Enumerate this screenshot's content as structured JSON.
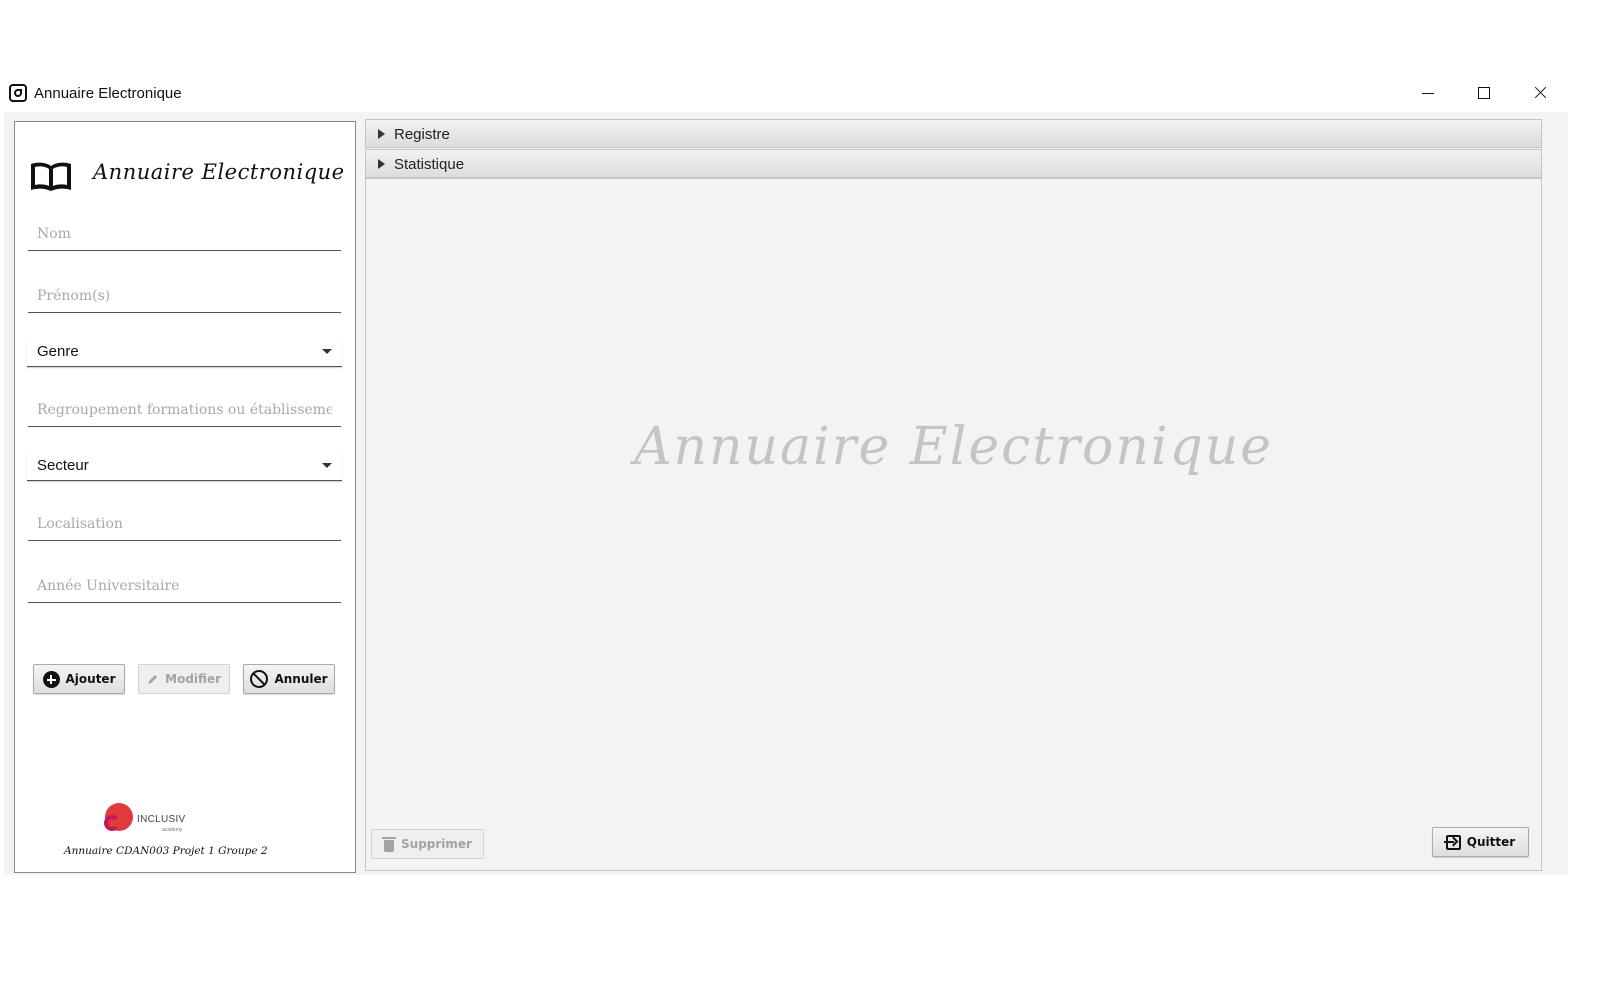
{
  "window": {
    "title": "Annuaire Electronique"
  },
  "sidebar": {
    "brand": "Annuaire Electronique",
    "fields": {
      "nom_placeholder": "Nom",
      "prenoms_placeholder": "Prénom(s)",
      "regroupement_placeholder": "Regroupement formations ou établissements",
      "localisation_placeholder": "Localisation",
      "annee_placeholder": "Année Universitaire"
    },
    "combos": {
      "genre": "Genre",
      "secteur": "Secteur"
    },
    "buttons": {
      "ajouter": "Ajouter",
      "modifier": "Modifier",
      "annuler": "Annuler"
    },
    "logo_text": "INCLUSIV",
    "logo_subtext": "academy",
    "footer": "Annuaire CDAN003 Projet 1 Groupe 2"
  },
  "main": {
    "accordion": [
      {
        "label": "Registre"
      },
      {
        "label": "Statistique"
      }
    ],
    "watermark": "Annuaire Electronique",
    "buttons": {
      "supprimer": "Supprimer",
      "quitter": "Quitter"
    }
  },
  "colors": {
    "logo_red": "#e03a3e",
    "logo_magenta": "#c2185b",
    "panel_bg": "#f3f3f3"
  }
}
